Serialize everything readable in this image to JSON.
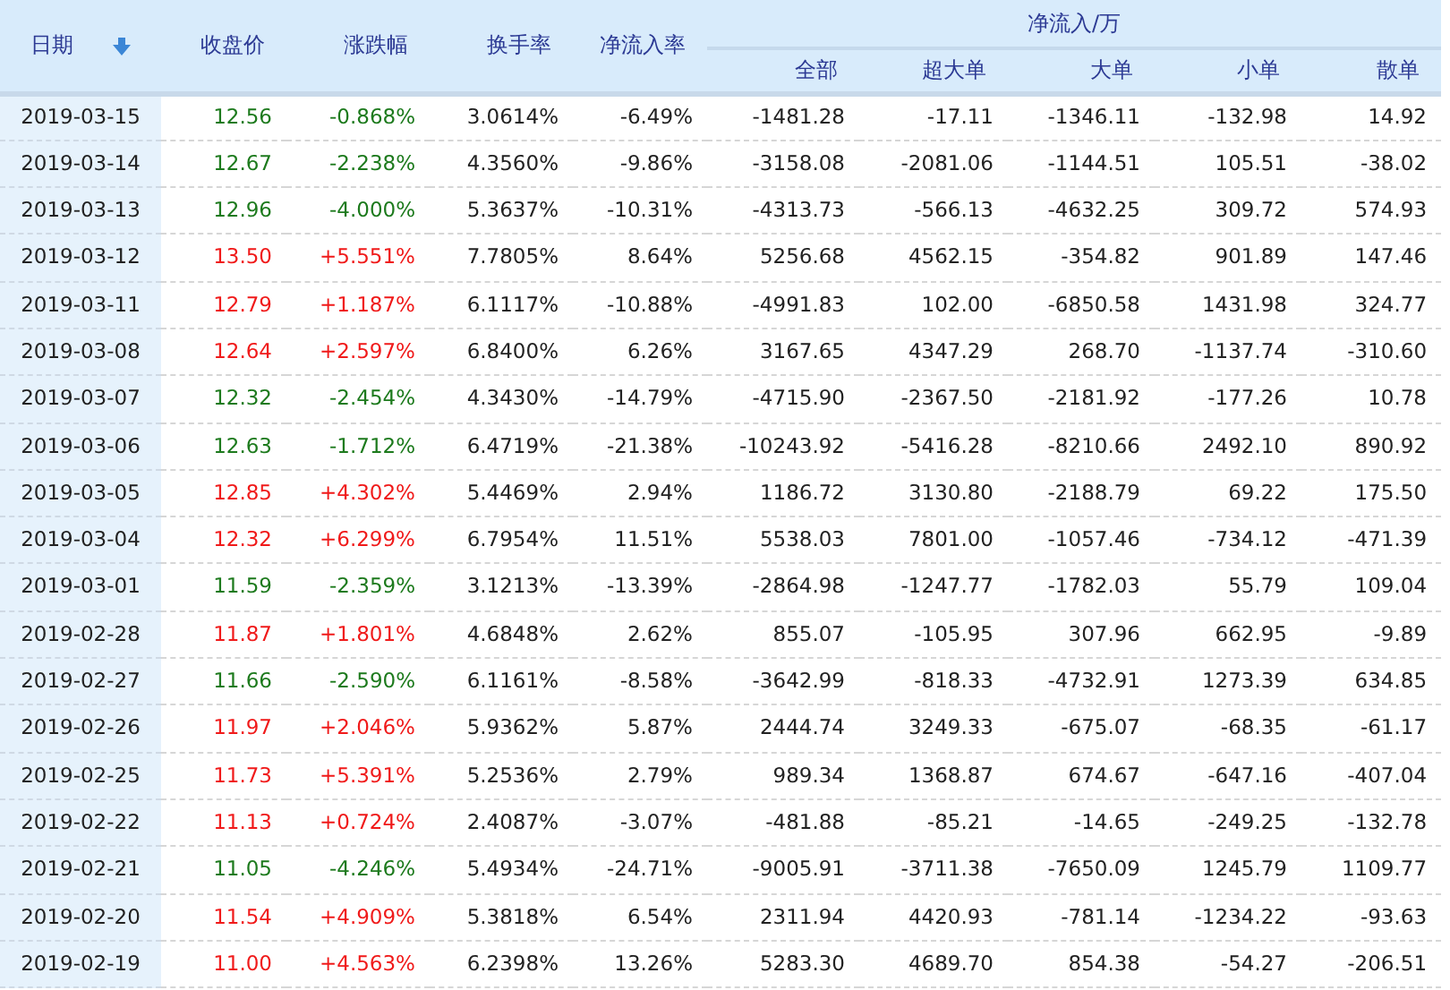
{
  "table": {
    "columns": [
      {
        "label": "日期",
        "sorted": true
      },
      {
        "label": "收盘价",
        "sorted": false
      },
      {
        "label": "涨跌幅",
        "sorted": false
      },
      {
        "label": "换手率",
        "sorted": false
      },
      {
        "label": "净流入率",
        "sorted": false
      }
    ],
    "group": {
      "label": "净流入/万",
      "columns": [
        "全部",
        "超大单",
        "大单",
        "小单",
        "散单"
      ]
    },
    "rows": [
      {
        "color": "#1d7a1d",
        "cells": [
          "2019-03-15",
          "12.56",
          "-0.868%",
          "3.0614%",
          "-6.49%",
          "-1481.28",
          "-17.11",
          "-1346.11",
          "-132.98",
          "14.92"
        ]
      },
      {
        "color": "#1d7a1d",
        "cells": [
          "2019-03-14",
          "12.67",
          "-2.238%",
          "4.3560%",
          "-9.86%",
          "-3158.08",
          "-2081.06",
          "-1144.51",
          "105.51",
          "-38.02"
        ]
      },
      {
        "color": "#1d7a1d",
        "cells": [
          "2019-03-13",
          "12.96",
          "-4.000%",
          "5.3637%",
          "-10.31%",
          "-4313.73",
          "-566.13",
          "-4632.25",
          "309.72",
          "574.93"
        ]
      },
      {
        "color": "#f01a1a",
        "cells": [
          "2019-03-12",
          "13.50",
          "+5.551%",
          "7.7805%",
          "8.64%",
          "5256.68",
          "4562.15",
          "-354.82",
          "901.89",
          "147.46"
        ]
      },
      {
        "color": "#f01a1a",
        "cells": [
          "2019-03-11",
          "12.79",
          "+1.187%",
          "6.1117%",
          "-10.88%",
          "-4991.83",
          "102.00",
          "-6850.58",
          "1431.98",
          "324.77"
        ]
      },
      {
        "color": "#f01a1a",
        "cells": [
          "2019-03-08",
          "12.64",
          "+2.597%",
          "6.8400%",
          "6.26%",
          "3167.65",
          "4347.29",
          "268.70",
          "-1137.74",
          "-310.60"
        ]
      },
      {
        "color": "#1d7a1d",
        "cells": [
          "2019-03-07",
          "12.32",
          "-2.454%",
          "4.3430%",
          "-14.79%",
          "-4715.90",
          "-2367.50",
          "-2181.92",
          "-177.26",
          "10.78"
        ]
      },
      {
        "color": "#1d7a1d",
        "cells": [
          "2019-03-06",
          "12.63",
          "-1.712%",
          "6.4719%",
          "-21.38%",
          "-10243.92",
          "-5416.28",
          "-8210.66",
          "2492.10",
          "890.92"
        ]
      },
      {
        "color": "#f01a1a",
        "cells": [
          "2019-03-05",
          "12.85",
          "+4.302%",
          "5.4469%",
          "2.94%",
          "1186.72",
          "3130.80",
          "-2188.79",
          "69.22",
          "175.50"
        ]
      },
      {
        "color": "#f01a1a",
        "cells": [
          "2019-03-04",
          "12.32",
          "+6.299%",
          "6.7954%",
          "11.51%",
          "5538.03",
          "7801.00",
          "-1057.46",
          "-734.12",
          "-471.39"
        ]
      },
      {
        "color": "#1d7a1d",
        "cells": [
          "2019-03-01",
          "11.59",
          "-2.359%",
          "3.1213%",
          "-13.39%",
          "-2864.98",
          "-1247.77",
          "-1782.03",
          "55.79",
          "109.04"
        ]
      },
      {
        "color": "#f01a1a",
        "cells": [
          "2019-02-28",
          "11.87",
          "+1.801%",
          "4.6848%",
          "2.62%",
          "855.07",
          "-105.95",
          "307.96",
          "662.95",
          "-9.89"
        ]
      },
      {
        "color": "#1d7a1d",
        "cells": [
          "2019-02-27",
          "11.66",
          "-2.590%",
          "6.1161%",
          "-8.58%",
          "-3642.99",
          "-818.33",
          "-4732.91",
          "1273.39",
          "634.85"
        ]
      },
      {
        "color": "#f01a1a",
        "cells": [
          "2019-02-26",
          "11.97",
          "+2.046%",
          "5.9362%",
          "5.87%",
          "2444.74",
          "3249.33",
          "-675.07",
          "-68.35",
          "-61.17"
        ]
      },
      {
        "color": "#f01a1a",
        "cells": [
          "2019-02-25",
          "11.73",
          "+5.391%",
          "5.2536%",
          "2.79%",
          "989.34",
          "1368.87",
          "674.67",
          "-647.16",
          "-407.04"
        ]
      },
      {
        "color": "#f01a1a",
        "cells": [
          "2019-02-22",
          "11.13",
          "+0.724%",
          "2.4087%",
          "-3.07%",
          "-481.88",
          "-85.21",
          "-14.65",
          "-249.25",
          "-132.78"
        ]
      },
      {
        "color": "#1d7a1d",
        "cells": [
          "2019-02-21",
          "11.05",
          "-4.246%",
          "5.4934%",
          "-24.71%",
          "-9005.91",
          "-3711.38",
          "-7650.09",
          "1245.79",
          "1109.77"
        ]
      },
      {
        "color": "#f01a1a",
        "cells": [
          "2019-02-20",
          "11.54",
          "+4.909%",
          "5.3818%",
          "6.54%",
          "2311.94",
          "4420.93",
          "-781.14",
          "-1234.22",
          "-93.63"
        ]
      },
      {
        "color": "#f01a1a",
        "cells": [
          "2019-02-19",
          "11.00",
          "+4.563%",
          "6.2398%",
          "13.26%",
          "5283.30",
          "4689.70",
          "854.38",
          "-54.27",
          "-206.51"
        ]
      }
    ]
  }
}
